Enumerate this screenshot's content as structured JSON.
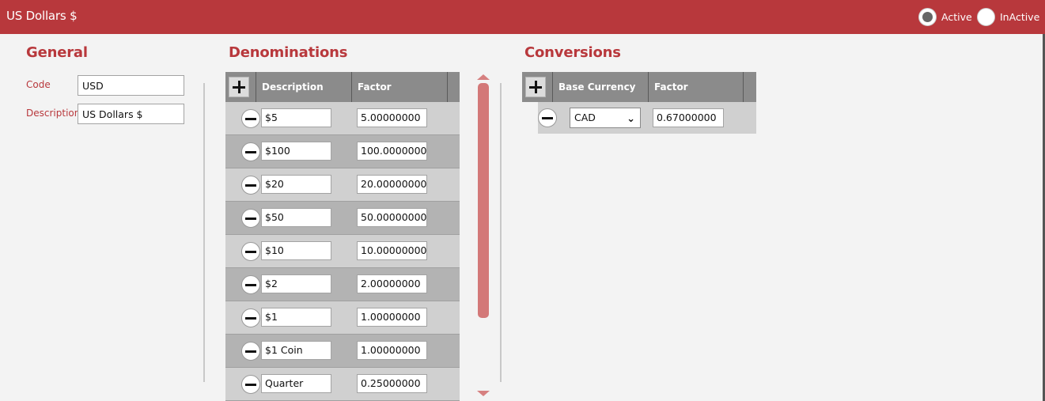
{
  "header": {
    "title": "US Dollars $",
    "status_options": [
      {
        "label": "Active",
        "checked": true
      },
      {
        "label": "InActive",
        "checked": false
      }
    ]
  },
  "general": {
    "title": "General",
    "code_label": "Code",
    "code_value": "USD",
    "description_label": "Description",
    "description_value": "US Dollars $"
  },
  "denominations": {
    "title": "Denominations",
    "columns": [
      "Description",
      "Factor"
    ],
    "rows": [
      {
        "description": "$5",
        "factor": "5.00000000"
      },
      {
        "description": "$100",
        "factor": "100.00000000"
      },
      {
        "description": "$20",
        "factor": "20.00000000"
      },
      {
        "description": "$50",
        "factor": "50.00000000"
      },
      {
        "description": "$10",
        "factor": "10.00000000"
      },
      {
        "description": "$2",
        "factor": "2.00000000"
      },
      {
        "description": "$1",
        "factor": "1.00000000"
      },
      {
        "description": "$1 Coin",
        "factor": "1.00000000"
      },
      {
        "description": "Quarter",
        "factor": "0.25000000"
      }
    ]
  },
  "conversions": {
    "title": "Conversions",
    "columns": [
      "Base Currency",
      "Factor"
    ],
    "rows": [
      {
        "base_currency": "CAD",
        "factor": "0.67000000"
      }
    ]
  },
  "colors": {
    "accent": "#b8383c",
    "header_gray": "#8b8b8b",
    "row_light": "#d0d0d0",
    "row_dark": "#b3b3b3",
    "scrollbar": "#d37878"
  },
  "icons": {
    "add": "plus-icon",
    "remove": "minus-icon",
    "dropdown": "chevron-down-icon"
  }
}
